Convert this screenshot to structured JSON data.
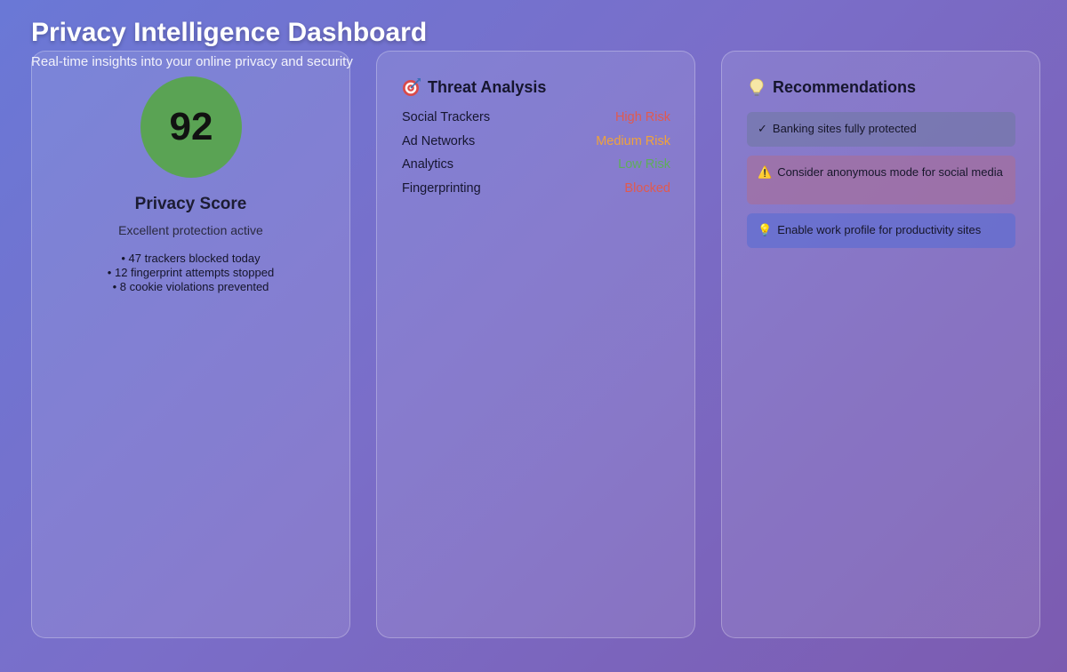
{
  "header": {
    "title": "Privacy Intelligence Dashboard",
    "subtitle": "Real-time insights into your online privacy and security"
  },
  "score_panel": {
    "score": "92",
    "label": "Privacy Score",
    "status": "Excellent protection active",
    "stats": [
      "• 47 trackers blocked today",
      "• 12 fingerprint attempts stopped",
      "• 8 cookie violations prevented"
    ],
    "color": "#5aa354"
  },
  "threat_panel": {
    "icon": "target-icon",
    "heading": "Threat Analysis",
    "rows": [
      {
        "name": "Social Trackers",
        "level": "High Risk",
        "color": "#e05a4f"
      },
      {
        "name": "Ad Networks",
        "level": "Medium Risk",
        "color": "#f0a23b"
      },
      {
        "name": "Analytics",
        "level": "Low Risk",
        "color": "#5fae5a"
      },
      {
        "name": "Fingerprinting",
        "level": "Blocked",
        "color": "#e05a4f"
      }
    ]
  },
  "recommendations_panel": {
    "icon": "lightbulb-icon",
    "heading": "Recommendations",
    "items": [
      {
        "icon": "✓",
        "text": "Banking sites fully protected"
      },
      {
        "icon": "⚠️",
        "text": "Consider anonymous mode for social media"
      },
      {
        "icon": "💡",
        "text": "Enable work profile for productivity sites"
      }
    ]
  }
}
